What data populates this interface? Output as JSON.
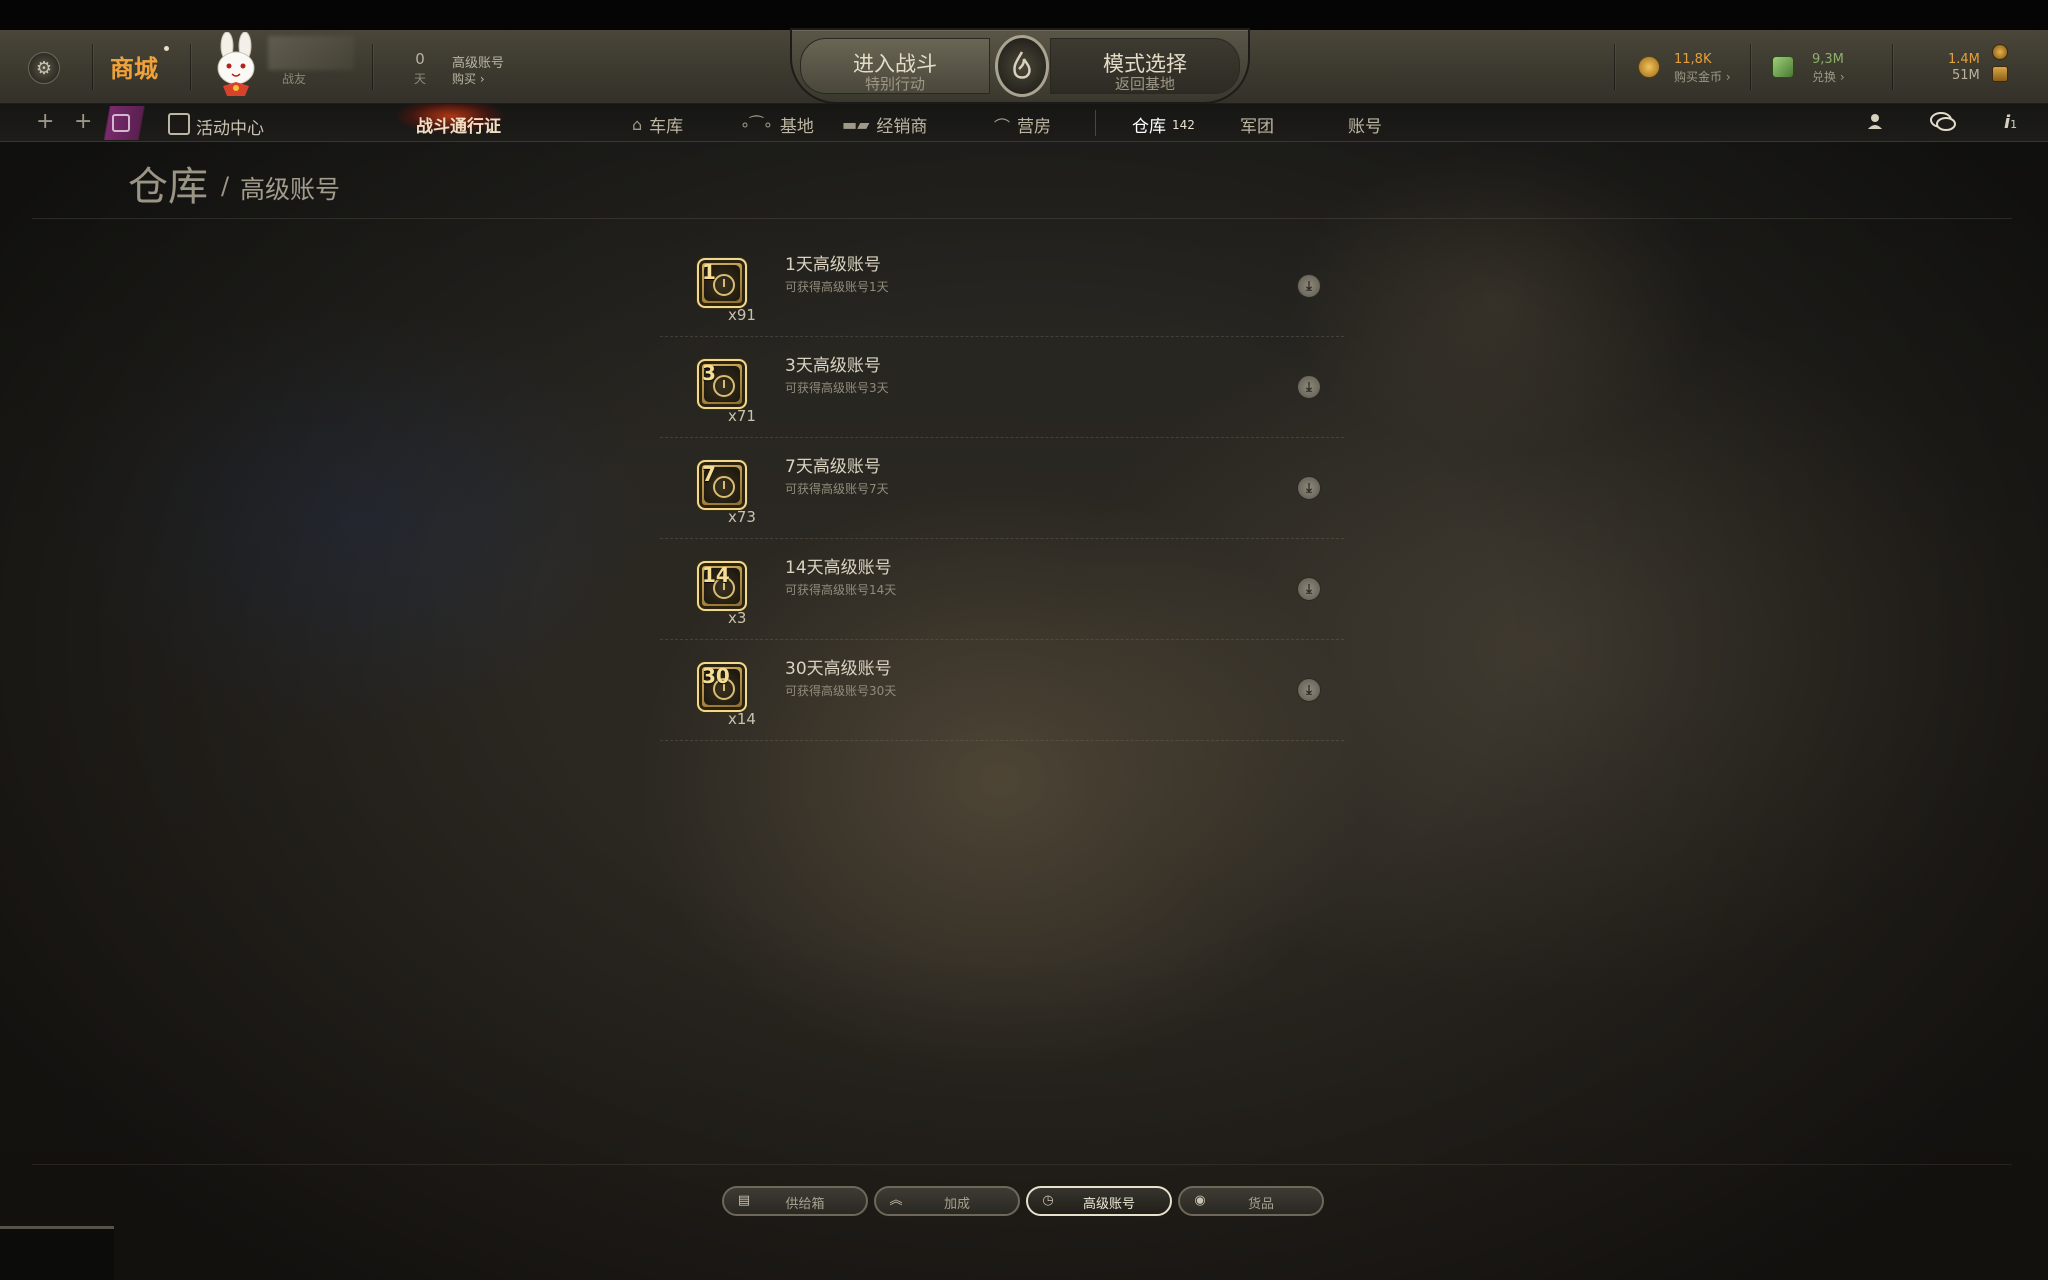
{
  "header": {
    "shop_label": "商城",
    "player_rank": "战友",
    "premium": {
      "days": "0",
      "days_unit": "天",
      "title": "高级账号",
      "buy_label": "购买 ›"
    },
    "battle": {
      "title": "进入战斗",
      "subtitle": "特别行动"
    },
    "mode": {
      "title": "模式选择",
      "subtitle": "返回基地"
    },
    "gold": {
      "value": "11,8K",
      "label": "购买金币 ›"
    },
    "credits": {
      "value": "9,3M",
      "label": "兑换 ›"
    },
    "exp": {
      "free_xp": "1.4M",
      "crew_xp": "51M"
    }
  },
  "nav": {
    "event_center": "活动中心",
    "battle_pass": "战斗通行证",
    "items": [
      {
        "label": "车库",
        "icon": "garage-icon"
      },
      {
        "label": "基地",
        "icon": "base-icon"
      },
      {
        "label": "经销商",
        "icon": "tank-dealer-icon"
      },
      {
        "label": "营房",
        "icon": "barracks-icon"
      },
      {
        "label": "仓库",
        "badge": "142",
        "active": true
      },
      {
        "label": "军团"
      },
      {
        "label": "账号"
      }
    ],
    "notifications_count": "1"
  },
  "breadcrumb": {
    "main": "仓库",
    "separator": "/",
    "sub": "高级账号"
  },
  "items": [
    {
      "icon_number": "1",
      "quantity": "x91",
      "title": "1天高级账号",
      "desc": "可获得高级账号1天"
    },
    {
      "icon_number": "3",
      "quantity": "x71",
      "title": "3天高级账号",
      "desc": "可获得高级账号3天"
    },
    {
      "icon_number": "7",
      "quantity": "x73",
      "title": "7天高级账号",
      "desc": "可获得高级账号7天"
    },
    {
      "icon_number": "14",
      "quantity": "x3",
      "title": "14天高级账号",
      "desc": "可获得高级账号14天"
    },
    {
      "icon_number": "30",
      "quantity": "x14",
      "title": "30天高级账号",
      "desc": "可获得高级账号30天"
    }
  ],
  "filters": [
    {
      "label": "供给箱",
      "icon": "supply-box-icon",
      "active": false
    },
    {
      "label": "加成",
      "icon": "boost-icon",
      "active": false
    },
    {
      "label": "高级账号",
      "icon": "premium-clock-icon",
      "active": true
    },
    {
      "label": "货品",
      "icon": "goods-icon",
      "active": false
    }
  ],
  "colors": {
    "accent_gold": "#e3a03d",
    "credits_green": "#8fb06a",
    "shop_orange": "#f0a23a"
  }
}
